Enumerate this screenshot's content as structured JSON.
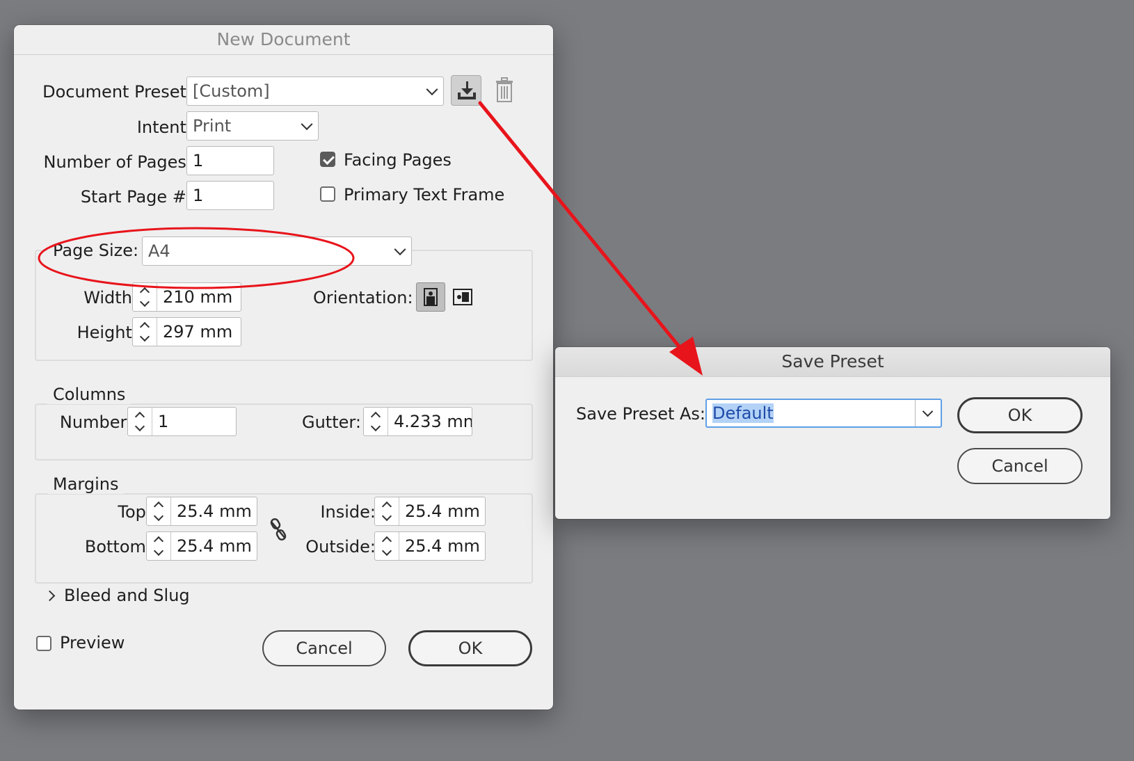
{
  "new_document": {
    "title": "New Document",
    "document_preset_label": "Document Preset:",
    "document_preset_value": "[Custom]",
    "intent_label": "Intent:",
    "intent_value": "Print",
    "number_of_pages_label": "Number of Pages:",
    "number_of_pages_value": "1",
    "start_page_label": "Start Page #:",
    "start_page_value": "1",
    "facing_pages_label": "Facing Pages",
    "facing_pages_checked": true,
    "primary_text_frame_label": "Primary Text Frame",
    "primary_text_frame_checked": false,
    "page_size_label": "Page Size:",
    "page_size_value": "A4",
    "width_label": "Width:",
    "width_value": "210 mm",
    "height_label": "Height:",
    "height_value": "297 mm",
    "orientation_label": "Orientation:",
    "columns": {
      "legend": "Columns",
      "number_label": "Number:",
      "number_value": "1",
      "gutter_label": "Gutter:",
      "gutter_value": "4.233 mn"
    },
    "margins": {
      "legend": "Margins",
      "top_label": "Top:",
      "top_value": "25.4 mm",
      "bottom_label": "Bottom:",
      "bottom_value": "25.4 mm",
      "inside_label": "Inside:",
      "inside_value": "25.4 mm",
      "outside_label": "Outside:",
      "outside_value": "25.4 mm"
    },
    "bleed_and_slug_label": "Bleed and Slug",
    "preview_label": "Preview",
    "preview_checked": false,
    "cancel_label": "Cancel",
    "ok_label": "OK"
  },
  "save_preset": {
    "title": "Save Preset",
    "save_as_label": "Save Preset As:",
    "save_as_value": "Default",
    "ok_label": "OK",
    "cancel_label": "Cancel"
  },
  "icons": {
    "save_preset": "download-tray-icon",
    "delete_preset": "trash-icon",
    "portrait": "portrait-orientation-icon",
    "landscape": "landscape-orientation-icon",
    "link": "broken-chain-link-icon",
    "disclosure": "chevron-right-icon"
  },
  "annotations": {
    "highlight_color": "#e8141b"
  }
}
